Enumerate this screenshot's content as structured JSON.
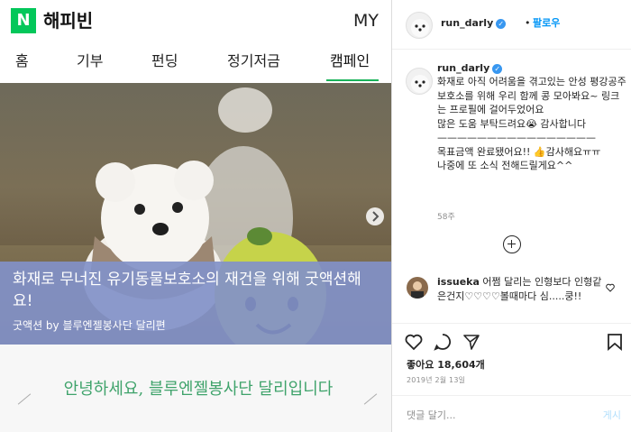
{
  "happybean": {
    "logo_letter": "N",
    "title": "해피빈",
    "my": "MY",
    "tabs": [
      "홈",
      "기부",
      "펀딩",
      "정기저금",
      "캠페인"
    ],
    "active_tab": "캠페인",
    "hero": {
      "title": "화재로 무너진 유기동물보호소의 재건을 위해 굿액션해요!",
      "subtitle": "굿액션 by 블루엔젤봉사단 달리편"
    },
    "greeting": "안녕하세요, 블루엔젤봉사단 달리입니다"
  },
  "instagram": {
    "username": "run_darly",
    "follow": "팔로우",
    "caption": "화재로 아직 어려움을 겪고있는 안성 평강공주보호소를 위해 우리 함께 콩 모아봐요~ 링크는 프로필에 걸어두었어요\n많은 도움 부탁드려요😭 감사합니다\n————————————————\n목표금액 완료됐어요!! 👍감사해요ㅠㅠ\n나중에 또 소식 전해드릴게요^^",
    "caption_time": "58주",
    "comment": {
      "username": "issueka",
      "text": "어쩜 달리는 인형보다 인형같은건지♡♡♡♡볼때마다 심.....쿵!!"
    },
    "likes": "좋아요 18,604개",
    "date": "2019년 2월 13일",
    "comment_placeholder": "댓글 달기...",
    "post_button": "게시"
  },
  "colors": {
    "naver_green": "#03c75a",
    "caption_overlay": "#8291c8",
    "greeting_green": "#3fa36b",
    "instagram_blue": "#0095f6"
  }
}
